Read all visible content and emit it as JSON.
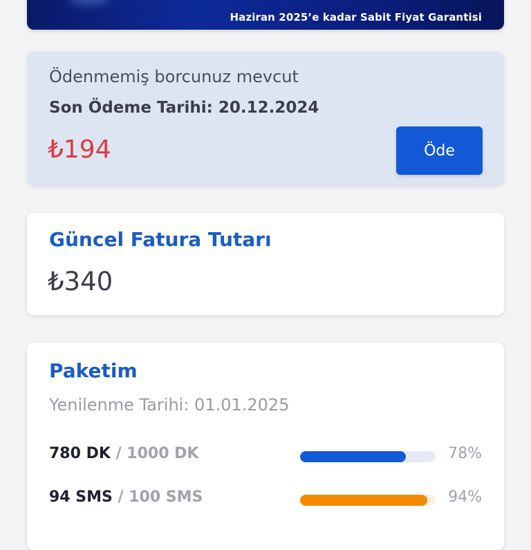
{
  "banner": {
    "text": "Haziran 2025’e kadar Sabit Fiyat Garantisi"
  },
  "debt": {
    "title": "Ödenmemiş borcunuz mevcut",
    "due_date": "Son Ödeme Tarihi: 20.12.2024",
    "amount": "₺194",
    "pay_label": "Öde"
  },
  "bill": {
    "title": "Güncel Fatura Tutarı",
    "amount": "₺340"
  },
  "package": {
    "title": "Paketim",
    "renewal": "Yenilenme Tarihi: 01.01.2025",
    "usage": [
      {
        "used": "780 DK",
        "sep": " / ",
        "total": "1000 DK",
        "percent": "78%",
        "fraction": 0.78,
        "color": "#1358d6",
        "track": "#e4ebf7"
      },
      {
        "used": "94 SMS",
        "sep": " / ",
        "total": "100 SMS",
        "percent": "94%",
        "fraction": 0.94,
        "color": "#f58a00",
        "track": "#fdf0de"
      }
    ]
  }
}
